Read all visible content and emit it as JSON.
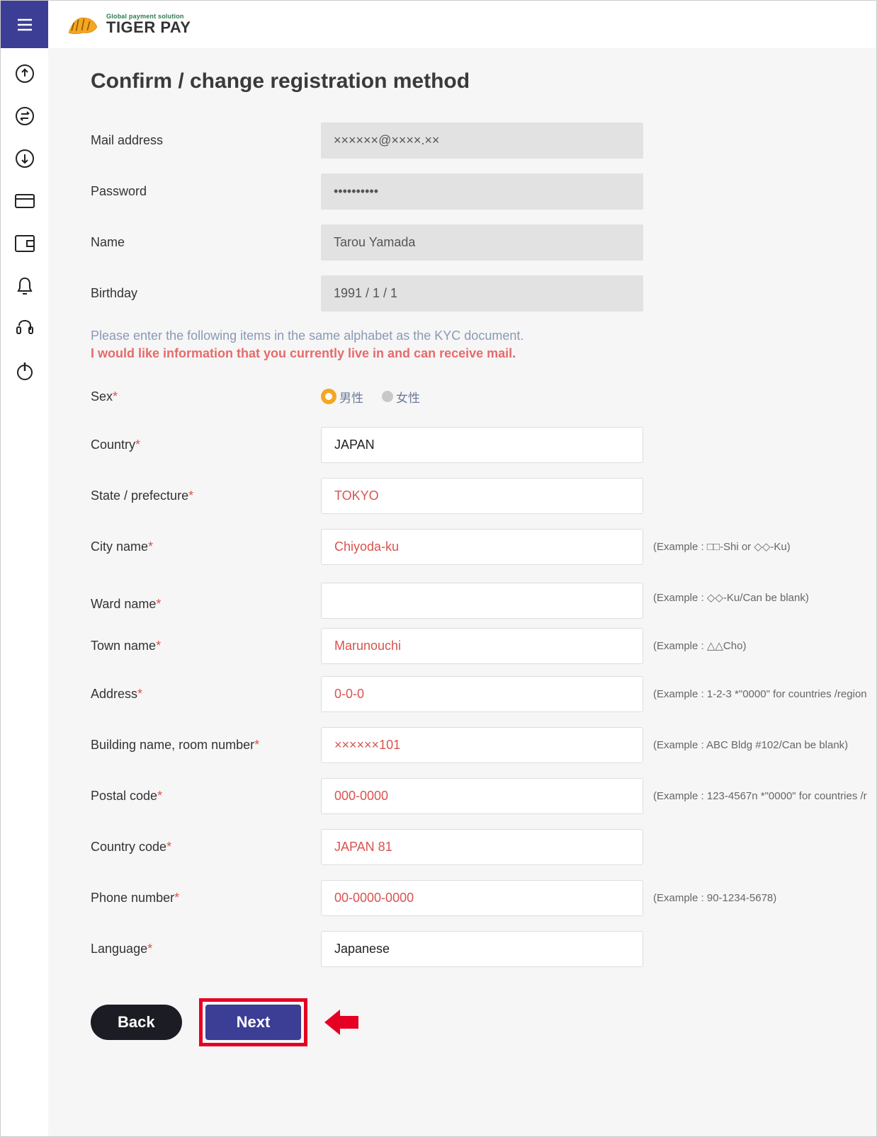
{
  "logo": {
    "tagline": "Global payment solution",
    "brand": "TIGER PAY"
  },
  "page": {
    "title": "Confirm / change registration method"
  },
  "instructions": {
    "line1": "Please enter the following items in the same alphabet as the KYC document.",
    "line2": "I would like information that you currently live in and can receive mail."
  },
  "labels": {
    "mail": "Mail address",
    "password": "Password",
    "name": "Name",
    "birthday": "Birthday",
    "sex": "Sex",
    "country": "Country",
    "state": "State / prefecture",
    "city": "City name",
    "ward": "Ward name",
    "town": "Town name",
    "address": "Address",
    "building": "Building name, room number",
    "postal": "Postal code",
    "country_code": "Country code",
    "phone": "Phone number",
    "language": "Language"
  },
  "values": {
    "mail": "××××××@××××.××",
    "password": "••••••••••",
    "name": "Tarou Yamada",
    "birthday": "1991 / 1 / 1",
    "country": "JAPAN",
    "state": "TOKYO",
    "city": "Chiyoda-ku",
    "ward": "",
    "town": "Marunouchi",
    "address": "0-0-0",
    "building": "××××××101",
    "postal": "000-0000",
    "country_code": "JAPAN 81",
    "phone": "00-0000-0000",
    "language": "Japanese"
  },
  "sex_options": {
    "male": "男性",
    "female": "女性"
  },
  "examples": {
    "city": "(Example : □□-Shi or ◇◇-Ku)",
    "ward": "(Example : ◇◇-Ku/Can be blank)",
    "town": "(Example : △△Cho)",
    "address": "(Example : 1-2-3 *\"0000\" for countries /region",
    "building": "(Example : ABC Bldg #102/Can be blank)",
    "postal": "(Example : 123-4567n *\"0000\" for countries /r",
    "phone": "(Example : 90-1234-5678)"
  },
  "buttons": {
    "back": "Back",
    "next": "Next"
  }
}
